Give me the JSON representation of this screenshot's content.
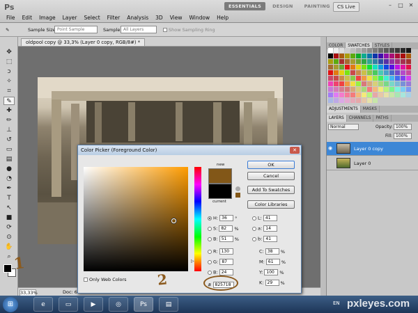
{
  "app": {
    "logo": "Ps"
  },
  "menu": [
    "File",
    "Edit",
    "Image",
    "Layer",
    "Select",
    "Filter",
    "Analysis",
    "3D",
    "View",
    "Window",
    "Help"
  ],
  "workspaces": [
    "ESSENTIALS",
    "DESIGN",
    "PAINTING"
  ],
  "cs_live": "CS Live",
  "options": {
    "sample_size_label": "Sample Size:",
    "sample_size_value": "Point Sample",
    "sample_label": "Sample:",
    "sample_value": "All Layers",
    "ring_label": "Show Sampling Ring"
  },
  "document": {
    "tab_title": "oldpool copy @ 33,3% (Layer 0 copy, RGB/8#) *",
    "zoom": "33,33%",
    "doc_size": "Doc: 6"
  },
  "panels": {
    "top_tabs": [
      "COLOR",
      "SWATCHES",
      "STYLES"
    ],
    "mid_tabs": [
      "ADJUSTMENTS",
      "MASKS"
    ],
    "layer_tabs": [
      "LAYERS",
      "CHANNELS",
      "PATHS"
    ],
    "blend_mode": "Normal",
    "opacity_label": "Opacity:",
    "opacity_value": "100%",
    "fill_label": "Fill:",
    "fill_value": "100%"
  },
  "layers": [
    {
      "name": "Layer 0 copy",
      "selected": true
    },
    {
      "name": "Layer 0",
      "selected": false
    }
  ],
  "picker": {
    "title": "Color Picker (Foreground Color)",
    "new_label": "new",
    "current_label": "current",
    "new_color": "#825718",
    "current_color": "#000000",
    "buttons": {
      "ok": "OK",
      "cancel": "Cancel",
      "add": "Add To Swatches",
      "libraries": "Color Libraries"
    },
    "only_web": "Only Web Colors",
    "fields": {
      "H": {
        "label": "H:",
        "value": "36",
        "unit": "°"
      },
      "S": {
        "label": "S:",
        "value": "82",
        "unit": "%"
      },
      "B": {
        "label": "B:",
        "value": "51",
        "unit": "%"
      },
      "R": {
        "label": "R:",
        "value": "130"
      },
      "G": {
        "label": "G:",
        "value": "87"
      },
      "Bl": {
        "label": "B:",
        "value": "24"
      },
      "L": {
        "label": "L:",
        "value": "41"
      },
      "a": {
        "label": "a:",
        "value": "14"
      },
      "b": {
        "label": "b:",
        "value": "41"
      },
      "C": {
        "label": "C:",
        "value": "38",
        "unit": "%"
      },
      "M": {
        "label": "M:",
        "value": "61",
        "unit": "%"
      },
      "Y": {
        "label": "Y:",
        "value": "100",
        "unit": "%"
      },
      "K": {
        "label": "K:",
        "value": "29",
        "unit": "%"
      },
      "hex": {
        "label": "#",
        "value": "825718"
      }
    }
  },
  "annotations": {
    "one": "1",
    "two": "2"
  },
  "taskbar": {
    "lang": "EN",
    "watermark": "pxleyes.com"
  },
  "colors": {
    "accent": "#3d87d6",
    "swatch_fg": "#000000",
    "swatch_bg": "#ffffff"
  }
}
